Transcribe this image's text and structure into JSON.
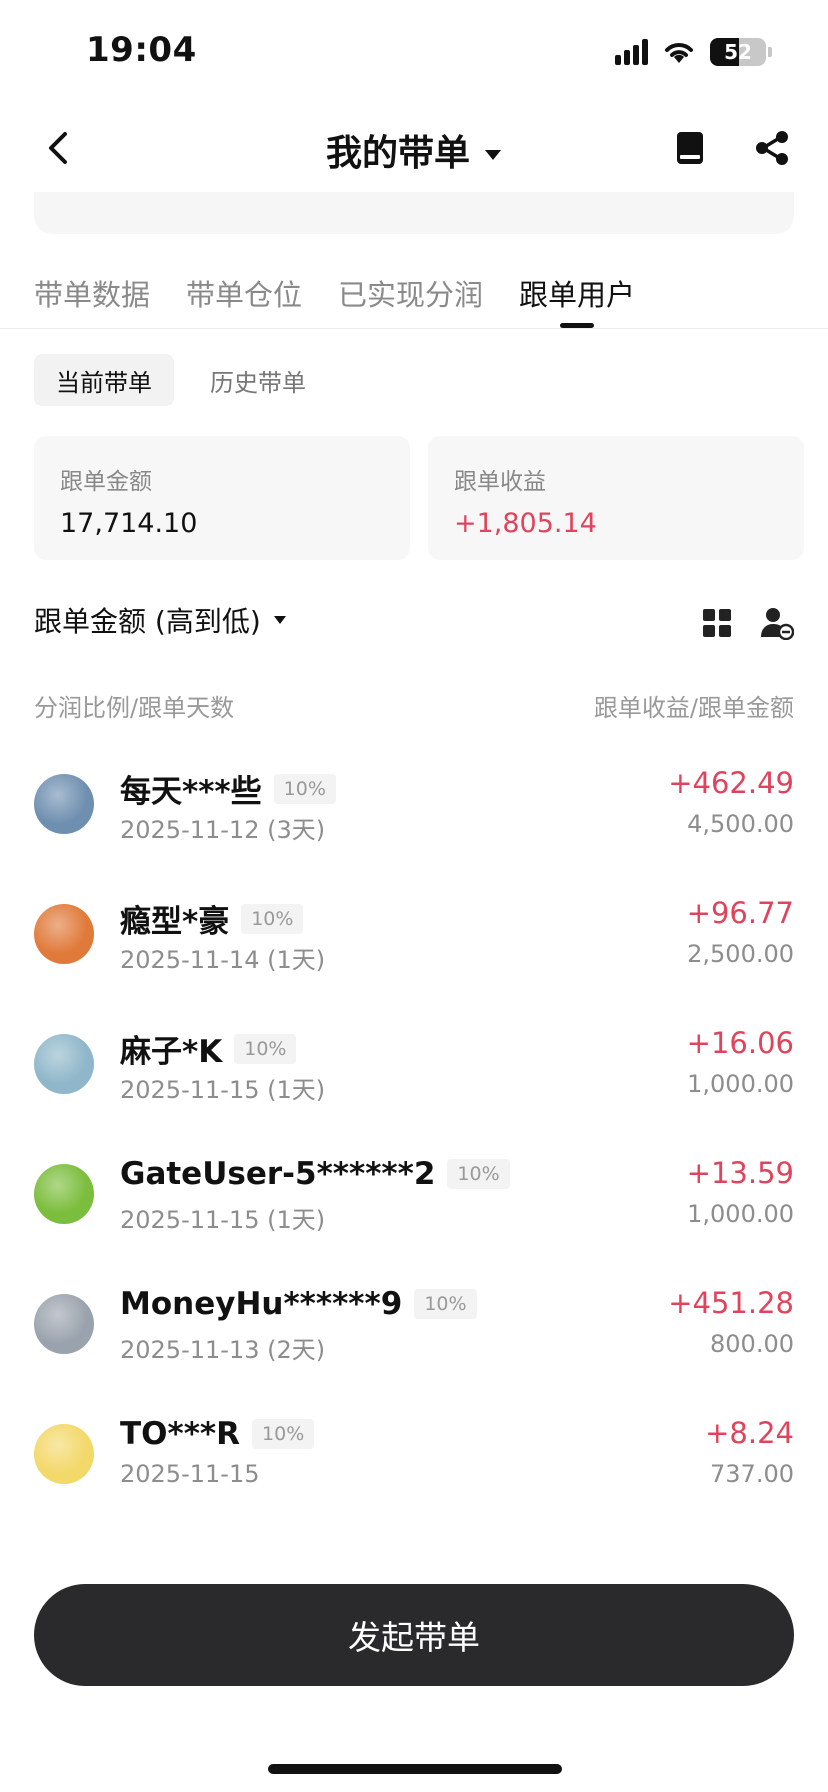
{
  "status_bar": {
    "time": "19:04",
    "battery": "52",
    "battery_level": 0.52
  },
  "nav": {
    "title": "我的带单",
    "back_icon": "chevron-left-icon",
    "book_icon": "book-icon",
    "share_icon": "share-icon"
  },
  "tabs": [
    {
      "label": "带单数据",
      "active": false
    },
    {
      "label": "带单仓位",
      "active": false
    },
    {
      "label": "已实现分润",
      "active": false
    },
    {
      "label": "跟单用户",
      "active": true
    }
  ],
  "segments": [
    {
      "label": "当前带单",
      "active": true
    },
    {
      "label": "历史带单",
      "active": false
    }
  ],
  "summary": {
    "amount_label": "跟单金额",
    "amount_value": "17,714.10",
    "profit_label": "跟单收益",
    "profit_value": "+1,805.14"
  },
  "sort": {
    "label": "跟单金额 (高到低)"
  },
  "columns": {
    "left": "分润比例/跟单天数",
    "right": "跟单收益/跟单金额"
  },
  "followers": [
    {
      "name": "每天***些",
      "pct": "10%",
      "date": "2025-11-12 (3天)",
      "profit": "+462.49",
      "amount": "4,500.00",
      "avatar_color": "#6f8fb0"
    },
    {
      "name": "瘾型*豪",
      "pct": "10%",
      "date": "2025-11-14 (1天)",
      "profit": "+96.77",
      "amount": "2,500.00",
      "avatar_color": "#e07a3a"
    },
    {
      "name": "麻子*K",
      "pct": "10%",
      "date": "2025-11-15 (1天)",
      "profit": "+16.06",
      "amount": "1,000.00",
      "avatar_color": "#8fb7c9"
    },
    {
      "name": "GateUser-5******2",
      "pct": "10%",
      "date": "2025-11-15 (1天)",
      "profit": "+13.59",
      "amount": "1,000.00",
      "avatar_color": "#7bbd3c"
    },
    {
      "name": "MoneyHu******9",
      "pct": "10%",
      "date": "2025-11-13 (2天)",
      "profit": "+451.28",
      "amount": "800.00",
      "avatar_color": "#9aa3ad"
    },
    {
      "name": "TO***R",
      "pct": "10%",
      "date": "2025-11-15",
      "profit": "+8.24",
      "amount": "737.00",
      "avatar_color": "#f3d86a"
    }
  ],
  "cta": {
    "label": "发起带单"
  }
}
